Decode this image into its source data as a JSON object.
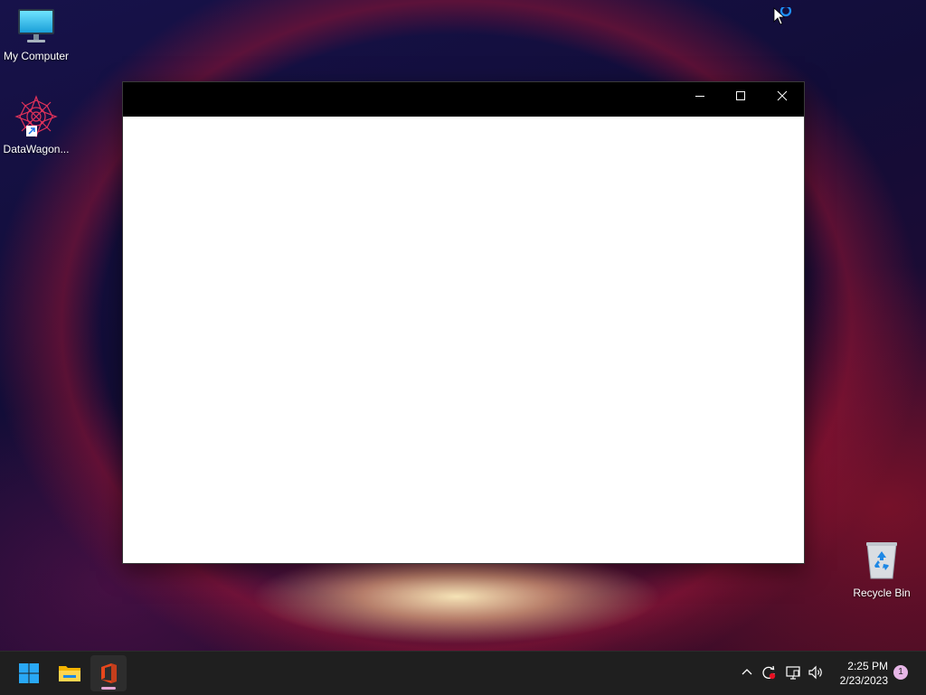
{
  "desktop": {
    "icons": [
      {
        "label": "My Computer",
        "icon": "monitor-icon"
      },
      {
        "label": "DataWagon...",
        "icon": "datawagon-app-icon"
      },
      {
        "label": "Recycle Bin",
        "icon": "recycle-bin-icon"
      }
    ]
  },
  "window": {
    "title": "",
    "controls": {
      "minimize": "minimize-icon",
      "maximize": "maximize-icon",
      "close": "close-icon"
    }
  },
  "taskbar": {
    "apps": [
      {
        "name": "start-button",
        "icon": "windows-logo-icon"
      },
      {
        "name": "file-explorer",
        "icon": "folder-icon"
      },
      {
        "name": "office",
        "icon": "office-icon",
        "active": true
      }
    ],
    "tray": {
      "icons": [
        "chevron-up-icon",
        "sync-icon",
        "network-icon",
        "volume-icon"
      ]
    },
    "clock": {
      "time": "2:25 PM",
      "date": "2/23/2023"
    },
    "notification_count": "1"
  },
  "colors": {
    "taskbar_bg": "#1f1f1f",
    "titlebar_bg": "#000000",
    "window_bg": "#ffffff",
    "accent": "#0078d4"
  }
}
